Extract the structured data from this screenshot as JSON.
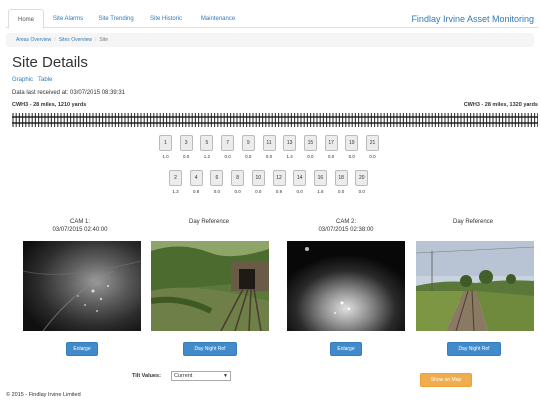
{
  "nav": {
    "tabs": [
      "Home",
      "Site Alarms",
      "Site Trending",
      "Site Historic",
      "Maintenance"
    ],
    "active_index": 0,
    "brand": "Findlay Irvine Asset Monitoring"
  },
  "breadcrumb": {
    "items": [
      "Areas Overview",
      "Sites Overview"
    ],
    "current": "Site"
  },
  "page": {
    "title": "Site Details",
    "views": [
      "Graphic",
      "Table"
    ],
    "data_received": "Data last received at: 03/07/2015 08:39:31",
    "location_left": "CWH3 - 28 miles, 1210 yards",
    "location_right": "CWH3 - 28 miles, 1320 yards"
  },
  "sensors_top": [
    {
      "id": "1",
      "value": "1.0"
    },
    {
      "id": "3",
      "value": "0.0"
    },
    {
      "id": "5",
      "value": "1.2"
    },
    {
      "id": "7",
      "value": "0.0"
    },
    {
      "id": "9",
      "value": "0.0"
    },
    {
      "id": "11",
      "value": "0.0"
    },
    {
      "id": "13",
      "value": "1.4"
    },
    {
      "id": "15",
      "value": "0.0"
    },
    {
      "id": "17",
      "value": "0.0"
    },
    {
      "id": "19",
      "value": "0.0"
    },
    {
      "id": "21",
      "value": "0.0"
    }
  ],
  "sensors_bottom": [
    {
      "id": "2",
      "value": "1.3"
    },
    {
      "id": "4",
      "value": "0.8"
    },
    {
      "id": "6",
      "value": "0.0"
    },
    {
      "id": "8",
      "value": "0.0"
    },
    {
      "id": "10",
      "value": "0.0"
    },
    {
      "id": "12",
      "value": "0.9"
    },
    {
      "id": "14",
      "value": "0.0"
    },
    {
      "id": "16",
      "value": "1.6"
    },
    {
      "id": "18",
      "value": "0.0"
    },
    {
      "id": "20",
      "value": "0.0"
    }
  ],
  "cameras": [
    {
      "title": "CAM 1:",
      "timestamp": "03/07/2015 02:40:00",
      "button": "Enlarge"
    },
    {
      "title": "Day Reference",
      "timestamp": "",
      "button": "Day Night Ref"
    },
    {
      "title": "CAM 2:",
      "timestamp": "03/07/2015 02:38:00",
      "button": "Enlarge"
    },
    {
      "title": "Day Reference",
      "timestamp": "",
      "button": "Day Night Ref"
    }
  ],
  "controls": {
    "tilt_label": "Tilt Values:",
    "tilt_value": "Current",
    "map_button": "Show on Map"
  },
  "footer": "© 2015 - Findlay Irvine Limited",
  "colors": {
    "link": "#337ab7",
    "primary_button": "#428bca",
    "warning_button": "#f0ad4e"
  }
}
